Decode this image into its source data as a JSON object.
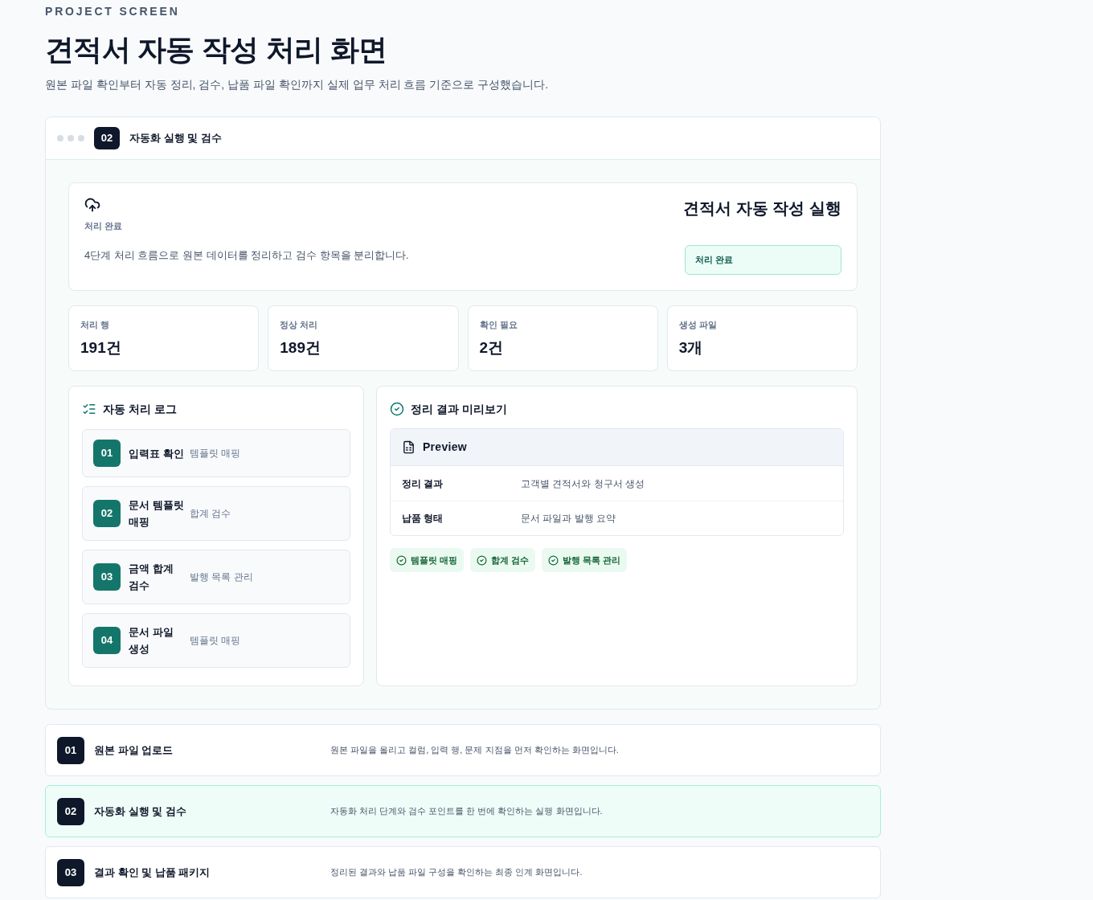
{
  "header": {
    "eyebrow": "PROJECT SCREEN",
    "title": "견적서 자동 작성 처리 화면",
    "subtitle": "원본 파일 확인부터 자동 정리, 검수, 납품 파일 확인까지 실제 업무 처리 흐름 기준으로 구성했습니다."
  },
  "panel": {
    "step": "02",
    "title": "자동화 실행 및 검수",
    "hero": {
      "label": "처리 완료",
      "description": "4단계 처리 흐름으로 원본 데이터를 정리하고 검수 항목을 분리합니다.",
      "title": "견적서 자동 작성 실행",
      "status": "처리 완료"
    },
    "stats": [
      {
        "label": "처리 행",
        "value": "191건"
      },
      {
        "label": "정상 처리",
        "value": "189건"
      },
      {
        "label": "확인 필요",
        "value": "2건"
      },
      {
        "label": "생성 파일",
        "value": "3개"
      }
    ],
    "log": {
      "title": "자동 처리 로그",
      "items": [
        {
          "number": "01",
          "title": "입력표 확인",
          "detail": "템플릿 매핑"
        },
        {
          "number": "02",
          "title": "문서 템플릿 매핑",
          "detail": "합계 검수"
        },
        {
          "number": "03",
          "title": "금액 합계 검수",
          "detail": "발행 목록 관리"
        },
        {
          "number": "04",
          "title": "문서 파일 생성",
          "detail": "템플릿 매핑"
        }
      ]
    },
    "preview": {
      "title": "정리 결과 미리보기",
      "table_title": "Preview",
      "rows": [
        {
          "label": "정리 결과",
          "value": "고객별 견적서와 청구서 생성"
        },
        {
          "label": "납품 형태",
          "value": "문서 파일과 발행 요약"
        }
      ],
      "tags": [
        "템플릿 매핑",
        "합계 검수",
        "발행 목록 관리"
      ]
    }
  },
  "screens": [
    {
      "number": "01",
      "title": "원본 파일 업로드",
      "description": "원본 파일을 올리고 컬럼, 입력 행, 문제 지점을 먼저 확인하는 화면입니다.",
      "selected": false
    },
    {
      "number": "02",
      "title": "자동화 실행 및 검수",
      "description": "자동화 처리 단계와 검수 포인트를 한 번에 확인하는 실행 화면입니다.",
      "selected": true
    },
    {
      "number": "03",
      "title": "결과 확인 및 납품 패키지",
      "description": "정리된 결과와 납품 파일 구성을 확인하는 최종 인계 화면입니다.",
      "selected": false
    }
  ]
}
